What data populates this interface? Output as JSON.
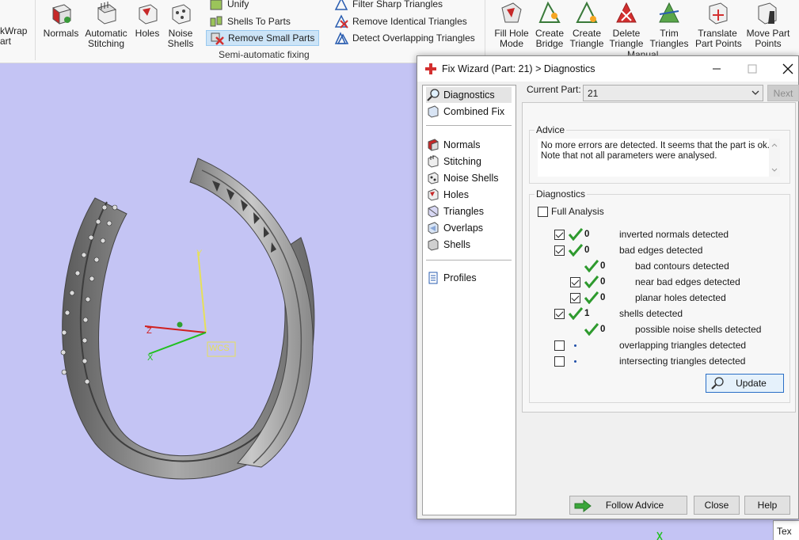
{
  "ribbon": {
    "left_cut_lines": [
      "kWrap",
      "art"
    ],
    "buttons": [
      {
        "lines": [
          "Normals"
        ]
      },
      {
        "lines": [
          "Automatic",
          "Stitching"
        ]
      },
      {
        "lines": [
          "Holes"
        ]
      },
      {
        "lines": [
          "Noise",
          "Shells"
        ]
      }
    ],
    "semi_auto": {
      "items": [
        "Unify",
        "Shells To Parts",
        "Remove Small Parts"
      ],
      "items2": [
        "Filter Sharp Triangles",
        "Remove Identical Triangles",
        "Detect Overlapping Triangles"
      ],
      "group_label": "Semi-automatic fixing"
    },
    "manual": {
      "buttons": [
        {
          "lines": [
            "Fill Hole",
            "Mode"
          ]
        },
        {
          "lines": [
            "Create",
            "Bridge"
          ]
        },
        {
          "lines": [
            "Create",
            "Triangle"
          ]
        },
        {
          "lines": [
            "Delete",
            "Triangle"
          ]
        },
        {
          "lines": [
            "Trim",
            "Triangles"
          ]
        },
        {
          "lines": [
            "Translate",
            "Part Points"
          ]
        },
        {
          "lines": [
            "Move Part",
            "Points"
          ]
        }
      ],
      "group_label": "Manual"
    }
  },
  "viewport": {
    "axis_labels": {
      "z": "Z",
      "x": "X",
      "y": "Y",
      "wcs": "WCS"
    },
    "corner_tab": "Tex"
  },
  "dialog": {
    "title": "Fix Wizard (Part: 21) > Diagnostics",
    "nav": {
      "top": [
        "Diagnostics",
        "Combined Fix"
      ],
      "tools": [
        "Normals",
        "Stitching",
        "Noise Shells",
        "Holes",
        "Triangles",
        "Overlaps",
        "Shells"
      ],
      "bottom": [
        "Profiles"
      ]
    },
    "current_part_label": "Current Part:",
    "current_part_value": "21",
    "next_label": "Next",
    "advice": {
      "legend": "Advice",
      "line1": "No more errors are detected. It seems that the part is ok.",
      "line2": "Note that not all parameters were analysed."
    },
    "diagnostics": {
      "legend": "Diagnostics",
      "full_analysis": "Full Analysis",
      "rows": [
        {
          "checked": true,
          "status": "ok",
          "count": "0",
          "label": "inverted normals detected"
        },
        {
          "checked": true,
          "status": "ok",
          "count": "0",
          "label": "bad edges detected"
        },
        {
          "checked": null,
          "status": "ok",
          "count": "0",
          "label": "bad contours detected"
        },
        {
          "checked": true,
          "status": "ok",
          "count": "0",
          "label": "near bad edges detected"
        },
        {
          "checked": true,
          "status": "ok",
          "count": "0",
          "label": "planar holes detected"
        },
        {
          "checked": true,
          "status": "ok",
          "count": "1",
          "label": "shells detected"
        },
        {
          "checked": null,
          "status": "ok",
          "count": "0",
          "label": "possible noise shells detected"
        },
        {
          "checked": false,
          "status": "none",
          "count": "",
          "label": "overlapping triangles detected"
        },
        {
          "checked": false,
          "status": "none",
          "count": "",
          "label": "intersecting triangles detected"
        }
      ],
      "update_label": "Update"
    },
    "follow_advice_label": "Follow Advice",
    "close_label": "Close",
    "help_label": "Help"
  },
  "colors": {
    "viewport_bg": "#c4c4f4",
    "check_green": "#2e9a2e",
    "selection_blue": "#cce4f7"
  }
}
